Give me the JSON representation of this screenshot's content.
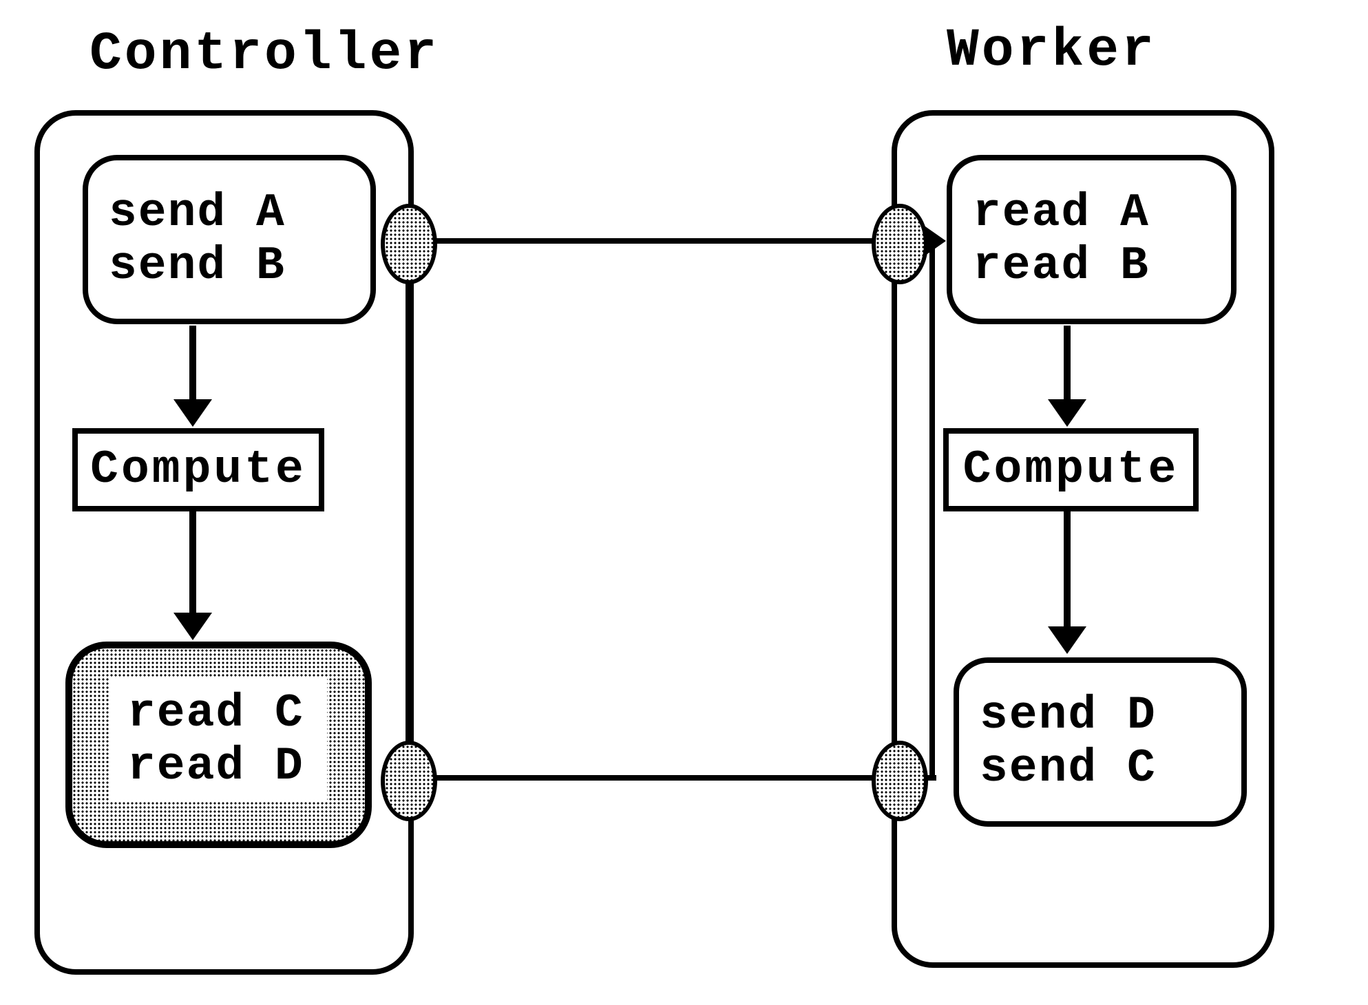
{
  "titles": {
    "controller": "Controller",
    "worker": "Worker"
  },
  "controller": {
    "sendA": "send  A",
    "sendB": "send  B",
    "compute": "Compute",
    "readC": "read  C",
    "readD": "read  D"
  },
  "worker": {
    "readA": "read  A",
    "readB": "read  B",
    "compute": "Compute",
    "sendD": "send  D",
    "sendC": "send  C"
  }
}
